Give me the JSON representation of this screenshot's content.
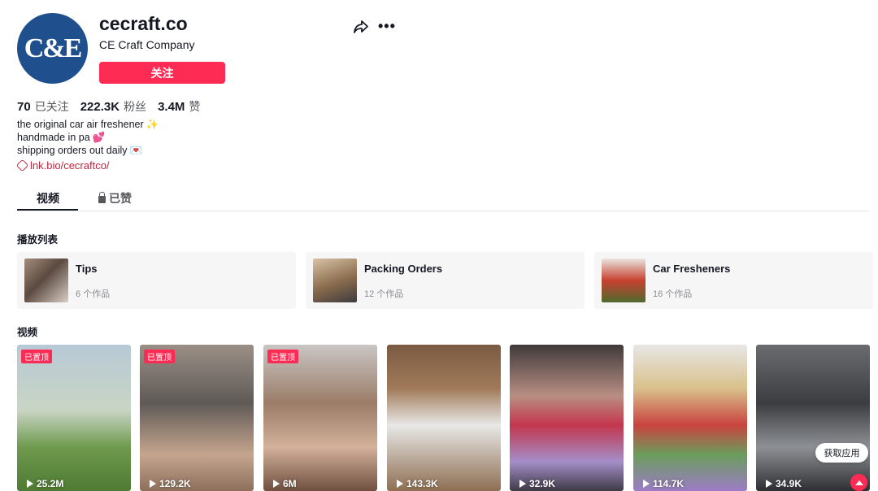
{
  "profile": {
    "avatar_text": "C&E",
    "username": "cecraft.co",
    "nickname": "CE Craft Company",
    "follow_label": "关注",
    "share_icon": "share-icon",
    "more_icon": "more-icon"
  },
  "stats": [
    {
      "value": "70",
      "label": "已关注"
    },
    {
      "value": "222.3K",
      "label": "粉丝"
    },
    {
      "value": "3.4M",
      "label": "赞"
    }
  ],
  "bio": {
    "line1": "the original car air freshener",
    "line1_emoji": "✨",
    "line2": "handmade in pa",
    "line2_emoji": "💕",
    "line3": "shipping orders out daily",
    "line3_emoji": "💌",
    "link": "lnk.bio/cecraftco/"
  },
  "tabs": {
    "videos": "视频",
    "liked": "已赞"
  },
  "playlists_title": "播放列表",
  "playlists": [
    {
      "title": "Tips",
      "count": "6 个作品"
    },
    {
      "title": "Packing Orders",
      "count": "12 个作品"
    },
    {
      "title": "Car Fresheners",
      "count": "16 个作品"
    }
  ],
  "videos_title": "视频",
  "pinned_label": "已置顶",
  "videos": [
    {
      "views": "25.2M",
      "pinned": true
    },
    {
      "views": "129.2K",
      "pinned": true
    },
    {
      "views": "6M",
      "pinned": true
    },
    {
      "views": "143.3K",
      "pinned": false
    },
    {
      "views": "32.9K",
      "pinned": false
    },
    {
      "views": "114.7K",
      "pinned": false
    },
    {
      "views": "34.9K",
      "pinned": false
    }
  ],
  "get_app_label": "获取应用",
  "colors": {
    "accent": "#fe2c55",
    "link": "#c8233f",
    "avatar_bg": "#1f4f8c"
  }
}
